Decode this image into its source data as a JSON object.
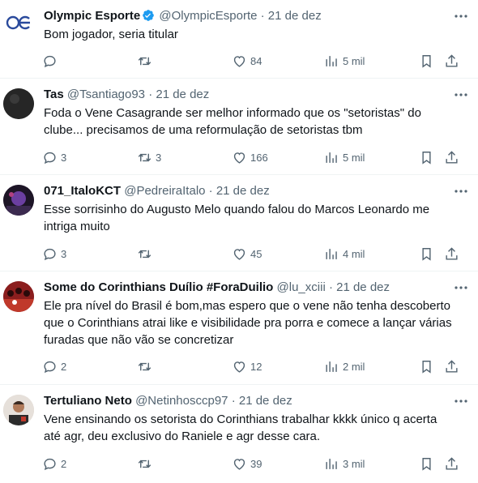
{
  "tweets": [
    {
      "name": "Olympic Esporte",
      "handle": "@OlympicEsporte",
      "date": "· 21 de dez",
      "text": "Bom jogador, seria titular",
      "replies": "",
      "retweets": "",
      "likes": "84",
      "views": "5 mil",
      "verified": true,
      "avatar": "olympic-logo"
    },
    {
      "name": "Tas",
      "handle": "@Tsantiago93",
      "date": "· 21 de dez",
      "text": "Foda o Vene Casagrande ser melhor informado que os \"setoristas\" do clube... precisamos de uma reformulação de setoristas tbm",
      "replies": "3",
      "retweets": "3",
      "likes": "166",
      "views": "5 mil",
      "verified": false,
      "avatar": "dark-avatar"
    },
    {
      "name": "071_ItaloKCT",
      "handle": "@PedreiraItalo",
      "date": "· 21 de dez",
      "text": "Esse sorrisinho do Augusto Melo quando falou do Marcos Leonardo me intriga muito",
      "replies": "3",
      "retweets": "",
      "likes": "45",
      "views": "4 mil",
      "verified": false,
      "avatar": "purple-avatar"
    },
    {
      "name": "Some do Corinthians Duílio #ForaDuilio",
      "handle": "@lu_xciii",
      "date": "· 21 de dez",
      "text": "Ele pra nível do Brasil é bom,mas espero que o vene não tenha descoberto que o Corinthians atrai like e visibilidade pra porra e comece a lançar várias furadas que não vão se concretizar",
      "replies": "2",
      "retweets": "",
      "likes": "12",
      "views": "2 mil",
      "verified": false,
      "avatar": "crowd-avatar"
    },
    {
      "name": "Tertuliano Neto",
      "handle": "@Netinhosccp97",
      "date": "· 21 de dez",
      "text": "Vene ensinando os setorista do Corinthians trabalhar kkkk único q acerta até agr, deu exclusivo do Raniele e agr desse cara.",
      "replies": "2",
      "retweets": "",
      "likes": "39",
      "views": "3 mil",
      "verified": false,
      "avatar": "person-avatar"
    }
  ],
  "colors": {
    "text": "#0f1419",
    "secondary": "#536471",
    "verified": "#1d9bf0",
    "divider": "#eff3f4"
  }
}
